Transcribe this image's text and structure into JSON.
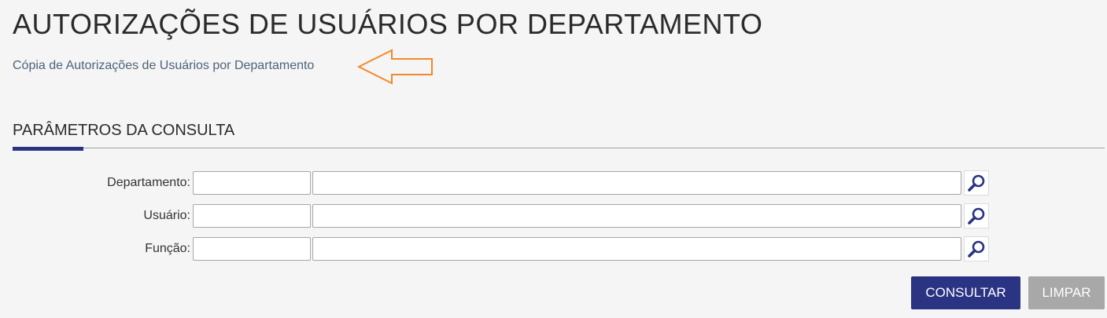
{
  "header": {
    "title": "AUTORIZAÇÕES DE USUÁRIOS POR DEPARTAMENTO",
    "link_text": "Cópia de Autorizações de Usuários por Departamento"
  },
  "section": {
    "title": "PARÂMETROS DA CONSULTA"
  },
  "form": {
    "fields": [
      {
        "label": "Departamento:",
        "code_value": "",
        "desc_value": ""
      },
      {
        "label": "Usuário:",
        "code_value": "",
        "desc_value": ""
      },
      {
        "label": "Função:",
        "code_value": "",
        "desc_value": ""
      }
    ]
  },
  "actions": {
    "consult_label": "CONSULTAR",
    "clear_label": "LIMPAR"
  },
  "colors": {
    "primary": "#2b3383",
    "disabled": "#a8a8a8",
    "link": "#4d6478",
    "annotation_arrow": "#f08a2c"
  },
  "icons": {
    "search": "magnifier-icon",
    "annotation": "arrow-left-icon"
  }
}
